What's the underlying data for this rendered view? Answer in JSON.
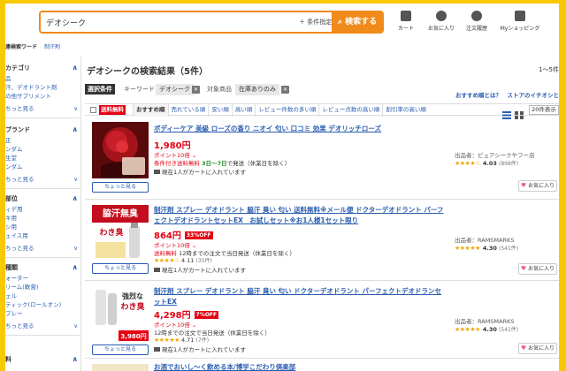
{
  "header": {
    "search_value": "デオシーク",
    "condition_label": "＋ 条件指定",
    "search_button": "検索する",
    "icons": [
      {
        "label": "カート",
        "icon": "cart-icon"
      },
      {
        "label": "お気に入り",
        "icon": "heart-icon"
      },
      {
        "label": "注文履歴",
        "icon": "history-icon"
      },
      {
        "label": "Myショッピング",
        "icon": "user-icon"
      }
    ]
  },
  "subbar": {
    "label": "連検索ワード",
    "link": "制汗剤"
  },
  "sidebar": {
    "sections": [
      {
        "title": "カテゴリ",
        "items": [
          "品",
          "汗、デオドラント剤",
          "の他サプリメント"
        ],
        "more": "ちっと見る"
      },
      {
        "title": "ブランド",
        "items": [
          "正",
          "ンダム",
          "生堂",
          "ンダム"
        ],
        "more": "ちっと見る"
      },
      {
        "title": "部位",
        "items": [
          "ィデ用",
          "キ用",
          "シ用",
          "ェイス用"
        ],
        "more": "ちっと見る"
      },
      {
        "title": "種類",
        "items": [
          "ォーター",
          "リーム(軟膏)",
          "ェル",
          "ティック(ロールオン)",
          "プレー"
        ],
        "more": "ちっと見る"
      },
      {
        "title": "料",
        "items": [],
        "more": ""
      }
    ]
  },
  "main": {
    "title": "デオシークの検索結果（5件）",
    "range": "1～5件",
    "cond_tag": "選択条件",
    "keyword_label": "キーワード",
    "keyword": "デオシーク",
    "target_label": "対象商品",
    "target": "在庫ありのみ",
    "links": "おすすめ順とは？　ストアのイチオシと",
    "free_ship": "送料無料",
    "sorts": [
      "おすすめ順",
      "売れている順",
      "安い順",
      "高い順",
      "レビュー件数の多い順",
      "レビュー点数の高い順",
      "割引率の高い順"
    ],
    "count": "20件表示"
  },
  "items": [
    {
      "name": "ボディーケア 美級 ローズの香り ニオイ 匂い 口コミ 効果 デオリッチローズ",
      "price": "1,980円",
      "off": "",
      "point": "ポイント10倍 ⌄",
      "ship_red": "条件付き送料無料",
      "ship_grn": "3日〜7日",
      "ship_rest": "で発送（休業日を除く）",
      "cart": "現在1人がカートに入れています",
      "review_score": "",
      "review_count": "",
      "seller": "出品者：ピュアシークヤフー店",
      "seller_score": "4.03",
      "seller_count": "(898件)",
      "look": "ちょっと見る",
      "fav": "お気に入り"
    },
    {
      "name": "制汗剤 スプレー デオドラント 脇汗 臭い 匂い 送料無料※メール便 ドクターデオドラント パーフェクトデオドラントセットEX　お試しセット※お1人様1セット限り",
      "price": "864円",
      "off": "33%OFF",
      "point": "ポイント10倍 ⌄",
      "ship_red": "送料無料",
      "ship_grn": "",
      "ship_rest": " 12時までの注文で当日発送（休業日を除く）",
      "cart": "現在1人がカートに入れています",
      "review_score": "4.11",
      "review_count": "(35件)",
      "seller": "出品者：RAMSMARKS",
      "seller_score": "4.30",
      "seller_count": "(541件)",
      "look": "ちょっと見る",
      "fav": "お気に入り"
    },
    {
      "name": "制汗剤 スプレー デオドラント 脇汗 臭い 匂い ドクターデオドラント パーフェクトデオドランセットEX",
      "price": "4,298円",
      "off": "7%OFF",
      "point": "ポイント10倍 ⌄",
      "ship_red": "",
      "ship_grn": "",
      "ship_rest": "12時までの注文で当日発送（休業日を除く）",
      "cart": "現在1人がカートに入れています",
      "review_score": "4.71",
      "review_count": "(7件)",
      "seller": "出品者：RAMSMARKS",
      "seller_score": "4.30",
      "seller_count": "(541件)",
      "look": "ちょっと見る",
      "fav": "お気に入り"
    },
    {
      "name": "お酒でおいし〜く飲める本/博学こだわり倶楽部"
    }
  ],
  "thumb_texts": {
    "t2a": "脇汗無臭",
    "t2b": "わき臭",
    "t3a": "強烈な",
    "t3b": "わき臭",
    "t3c": "3,980円"
  }
}
